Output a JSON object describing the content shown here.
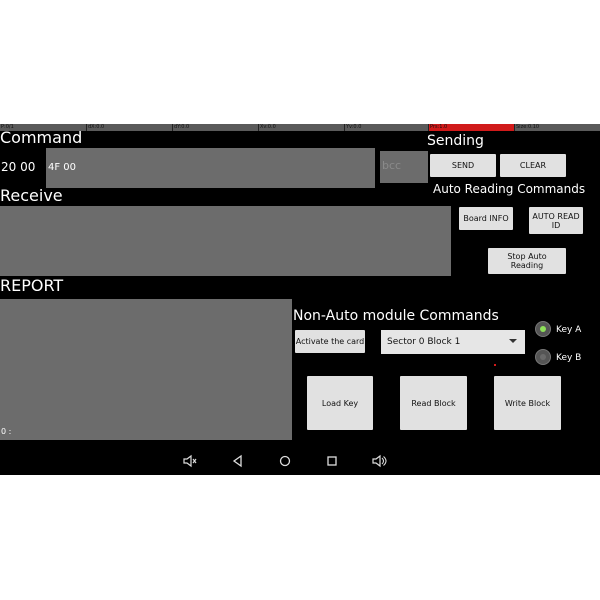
{
  "debug_bar": {
    "p": "P:0/1",
    "dx": "dX:0.0",
    "dy": "dY:0.0",
    "xv": "Xv:0.0",
    "yv": "Yv:0.0",
    "prs": "Prs:1.0",
    "size": "Size:0.10",
    "highlight_color": "#d11a1a"
  },
  "command": {
    "title": "Command",
    "prefix": "20 00",
    "value": "4F 00",
    "bcc_placeholder": "bcc"
  },
  "sending": {
    "title": "Sending",
    "send_label": "SEND",
    "clear_label": "CLEAR"
  },
  "auto": {
    "title": "Auto Reading Commands",
    "board_info_label": "Board INFO",
    "auto_read_id_label": "AUTO READ ID",
    "stop_label": "Stop Auto Reading"
  },
  "receive": {
    "title": "Receive"
  },
  "report": {
    "title": "REPORT",
    "footer": "0 :"
  },
  "non_auto": {
    "title": "Non-Auto module Commands",
    "activate_label": "Activate the card",
    "sector_select": "Sector 0 Block 1",
    "key_a": "Key A",
    "key_b": "Key B",
    "load_key_label": "Load Key",
    "read_block_label": "Read Block",
    "write_block_label": "Write Block"
  },
  "nav": {
    "volume_down": "volume-down-icon",
    "back": "back-icon",
    "home": "home-icon",
    "recents": "recents-icon",
    "volume_up": "volume-up-icon"
  },
  "colors": {
    "radio_active": "#8ee05a"
  }
}
